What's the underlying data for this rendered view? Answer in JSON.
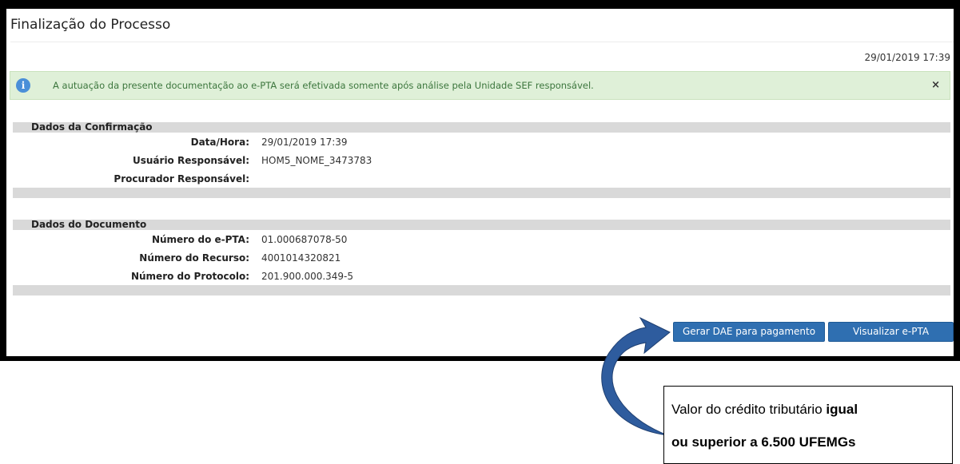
{
  "page": {
    "title": "Finalização do Processo",
    "timestamp": "29/01/2019 17:39"
  },
  "alert": {
    "icon": "info-icon",
    "text": "A autuação da presente documentação ao e-PTA será efetivada somente após análise pela Unidade SEF responsável.",
    "close": "×"
  },
  "confirmacao": {
    "header": "Dados da Confirmação",
    "rows": [
      {
        "label": "Data/Hora:",
        "value": "29/01/2019 17:39"
      },
      {
        "label": "Usuário Responsável:",
        "value": "HOM5_NOME_3473783"
      },
      {
        "label": "Procurador Responsável:",
        "value": ""
      }
    ]
  },
  "documento": {
    "header": "Dados do Documento",
    "rows": [
      {
        "label": "Número do e-PTA:",
        "value": "01.000687078-50"
      },
      {
        "label": "Número do Recurso:",
        "value": "4001014320821"
      },
      {
        "label": "Número do Protocolo:",
        "value": "201.900.000.349-5"
      }
    ]
  },
  "buttons": {
    "gerar_dae": "Gerar DAE para pagamento",
    "visualizar": "Visualizar e-PTA"
  },
  "callout": {
    "text_start": "Valor do crédito tributário ",
    "text_bold1": "igual",
    "text_bold2": "ou superior a 6.500 UFEMGs"
  },
  "colors": {
    "primary_button": "#2f6fb1",
    "alert_bg": "#dff0d8",
    "arrow": "#2e5c9e"
  }
}
